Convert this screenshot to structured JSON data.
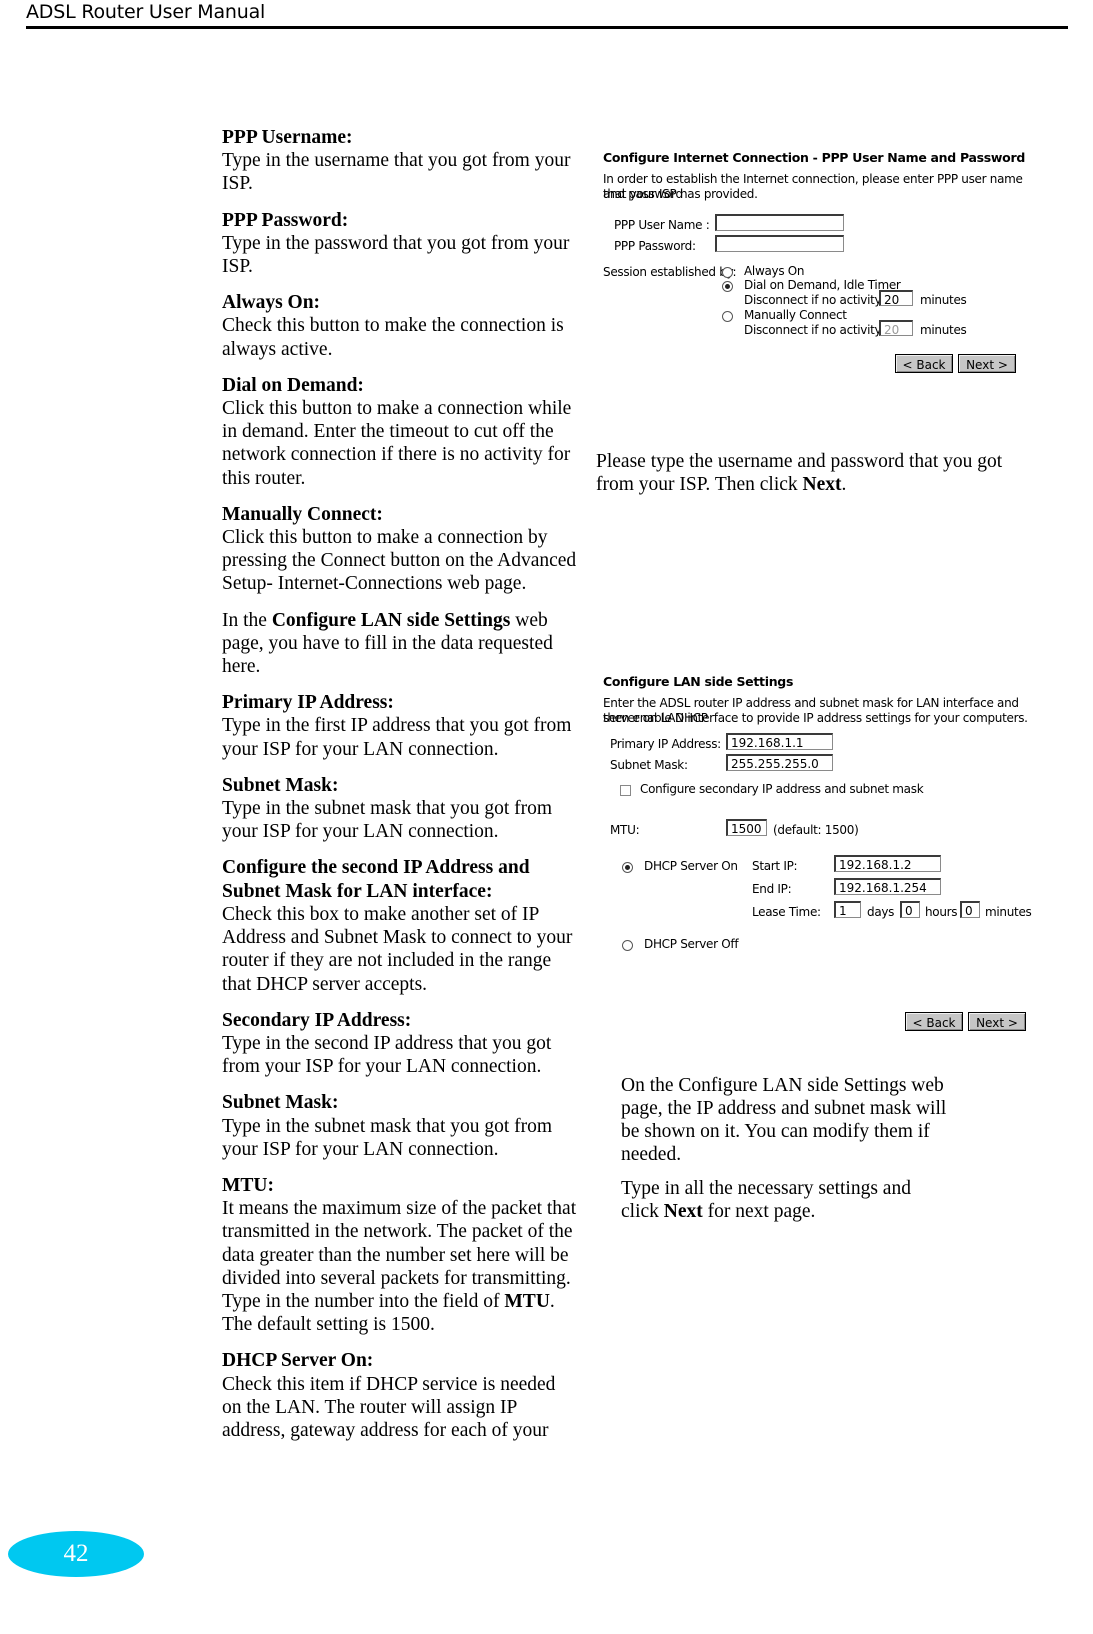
{
  "header": {
    "title": "ADSL Router User Manual"
  },
  "footer": {
    "page_number": "42",
    "badge_color": "#00c8f0"
  },
  "left_column": {
    "sections": [
      {
        "heading": "PPP Username:",
        "body": "Type in the username that you got from your ISP."
      },
      {
        "heading": "PPP Password:",
        "body": "Type in the password that you got from your ISP."
      },
      {
        "heading": "Always On:",
        "body": "Check this button to make the connection is always active."
      },
      {
        "heading": "Dial on Demand:",
        "body": "Click this button to make a connection while in demand. Enter the timeout to cut off the network connection if there is no activity for this router."
      },
      {
        "heading": "Manually Connect:",
        "body": "Click this button to make a connection by pressing the Connect button on the Advanced Setup- Internet-Connections web page."
      },
      {
        "heading": "",
        "body_pre": "In the ",
        "body_bold": "Configure LAN side Settings",
        "body_post": " web page, you have to fill in the data requested here."
      },
      {
        "heading": "Primary IP Address:",
        "body": "Type in the first IP address that you got from your ISP for your LAN connection."
      },
      {
        "heading": "Subnet Mask:",
        "body": "Type in the subnet mask that you got from your ISP for your LAN connection."
      },
      {
        "heading": "Configure the second IP Address and Subnet Mask for LAN interface:",
        "body": "Check this box to make another set of IP Address and Subnet Mask to connect to your router if they are not included in the range that DHCP server accepts."
      },
      {
        "heading": "Secondary IP Address:",
        "body": "Type in the second IP address that you got from your ISP for your LAN connection."
      },
      {
        "heading": "Subnet Mask:",
        "body": "Type in the subnet mask that you got from your ISP for your LAN connection."
      },
      {
        "heading": "MTU:",
        "body_pre": "It means the maximum size of the packet that transmitted in the network. The packet of the data greater than the number set here will be divided into several packets for transmitting. Type in the number into the field of ",
        "body_bold": "MTU",
        "body_post": ". The default setting is 1500."
      },
      {
        "heading": "DHCP Server On:",
        "body": "Check this item if DHCP service is needed on the LAN. The router will assign IP address, gateway address for each of your"
      }
    ]
  },
  "right_column": {
    "para_1_pre": "Please type the username and password that you got from your ISP. Then click ",
    "para_1_bold": "Next",
    "para_1_post": ".",
    "para_2": "On the Configure LAN side Settings web page, the IP address and subnet mask will be shown on it. You can modify them if needed.",
    "para_3_pre": "Type in all the necessary settings and click ",
    "para_3_bold": "Next",
    "para_3_post": " for next page."
  },
  "screenshot_ppp": {
    "title": "Configure Internet Connection - PPP User Name and Password",
    "description_line_1": "In order to establish the Internet connection, please enter PPP user name and password",
    "description_line_2": "that your ISP has provided.",
    "fields": [
      {
        "label": "PPP User Name :",
        "value": ""
      },
      {
        "label": "PPP Password:",
        "value": ""
      }
    ],
    "session_label": "Session established by:",
    "options": [
      {
        "label": "Always On",
        "selected": false
      },
      {
        "label": "Dial on Demand, Idle Timer",
        "selected": true
      },
      {
        "label": "Manually Connect",
        "selected": false
      }
    ],
    "idle_row_1": {
      "prefix": "Disconnect if no activity for",
      "value": "20",
      "suffix": "minutes"
    },
    "idle_row_2": {
      "prefix": "Disconnect if no activity for",
      "value": "20",
      "suffix": "minutes"
    },
    "back_button": "< Back",
    "next_button": "Next >"
  },
  "screenshot_lan": {
    "title": "Configure LAN side Settings",
    "description_line_1": "Enter the ADSL router IP address and subnet mask for LAN interface and then enable DHCP",
    "description_line_2": "server on LAN interface to provide IP address settings for your computers.",
    "primary_ip_label": "Primary IP Address:",
    "primary_ip_value": "192.168.1.1",
    "subnet_mask_label": "Subnet Mask:",
    "subnet_mask_value": "255.255.255.0",
    "secondary_checkbox_label": "Configure secondary IP address and subnet mask",
    "secondary_checkbox_checked": false,
    "mtu_label": "MTU:",
    "mtu_value": "1500",
    "mtu_default_note": "(default: 1500)",
    "dhcp_on_label": "DHCP Server On",
    "dhcp_on_selected": true,
    "dhcp_off_label": "DHCP Server Off",
    "dhcp_off_selected": false,
    "start_ip_label": "Start IP:",
    "start_ip_value": "192.168.1.2",
    "end_ip_label": "End IP:",
    "end_ip_value": "192.168.1.254",
    "lease_time_label": "Lease Time:",
    "lease_days_value": "1",
    "lease_days_unit": "days",
    "lease_hours_value": "0",
    "lease_hours_unit": "hours",
    "lease_minutes_value": "0",
    "lease_minutes_unit": "minutes",
    "back_button": "< Back",
    "next_button": "Next >"
  }
}
